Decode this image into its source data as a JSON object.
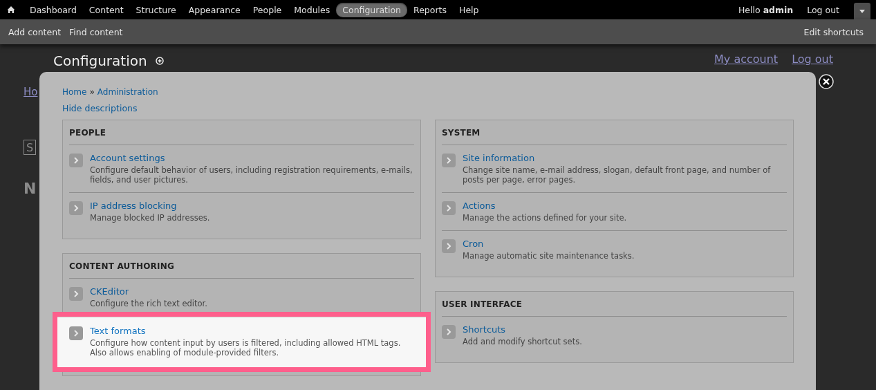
{
  "toolbar": {
    "menu": [
      {
        "label": "Dashboard",
        "selected": false
      },
      {
        "label": "Content",
        "selected": false
      },
      {
        "label": "Structure",
        "selected": false
      },
      {
        "label": "Appearance",
        "selected": false
      },
      {
        "label": "People",
        "selected": false
      },
      {
        "label": "Modules",
        "selected": false
      },
      {
        "label": "Configuration",
        "selected": true
      },
      {
        "label": "Reports",
        "selected": false
      },
      {
        "label": "Help",
        "selected": false
      }
    ],
    "greeting": "Hello **admin**",
    "logout": "Log out"
  },
  "shortcuts": {
    "items": [
      "Add content",
      "Find content"
    ],
    "edit": "Edit shortcuts"
  },
  "background_page": {
    "links": [
      "My account",
      "Log out"
    ],
    "fragments": [
      "Ho",
      "S",
      "N"
    ]
  },
  "overlay": {
    "title": "Configuration",
    "breadcrumb": [
      "Home",
      "Administration"
    ],
    "separator": "»",
    "toggle": "Hide descriptions",
    "columns": [
      [
        {
          "title": "PEOPLE",
          "items": [
            {
              "title": "Account settings",
              "description": "Configure default behavior of users, including registration requirements, e-mails, fields, and user pictures.",
              "highlighted": false
            },
            {
              "title": "IP address blocking",
              "description": "Manage blocked IP addresses.",
              "highlighted": false
            }
          ]
        },
        {
          "title": "CONTENT AUTHORING",
          "items": [
            {
              "title": "CKEditor",
              "description": "Configure the rich text editor.",
              "highlighted": false
            },
            {
              "title": "Text formats",
              "description": "Configure how content input by users is filtered, including allowed HTML tags. Also allows enabling of module-provided filters.",
              "highlighted": true
            }
          ]
        }
      ],
      [
        {
          "title": "SYSTEM",
          "items": [
            {
              "title": "Site information",
              "description": "Change site name, e-mail address, slogan, default front page, and number of posts per page, error pages.",
              "highlighted": false
            },
            {
              "title": "Actions",
              "description": "Manage the actions defined for your site.",
              "highlighted": false
            },
            {
              "title": "Cron",
              "description": "Manage automatic site maintenance tasks.",
              "highlighted": false
            }
          ]
        },
        {
          "title": "USER INTERFACE",
          "items": [
            {
              "title": "Shortcuts",
              "description": "Add and modify shortcut sets.",
              "highlighted": false
            }
          ]
        }
      ]
    ]
  }
}
